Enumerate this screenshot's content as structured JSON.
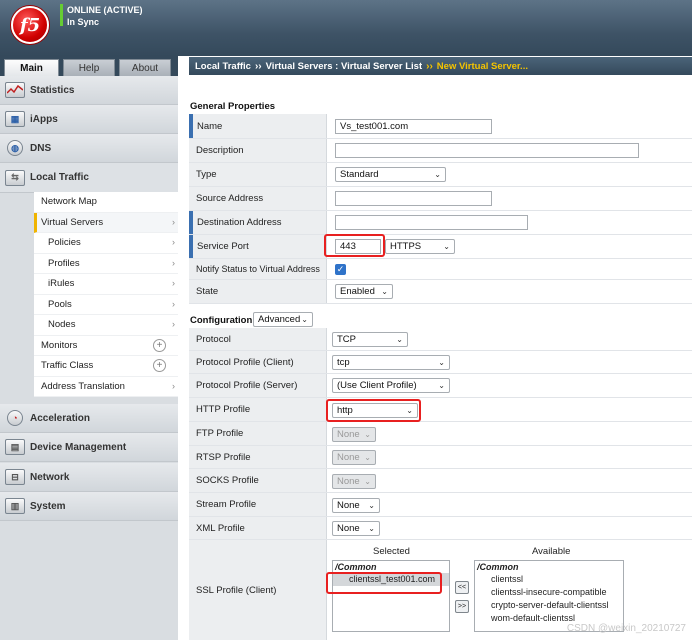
{
  "header": {
    "logo_text": "f5",
    "status_line1": "ONLINE (ACTIVE)",
    "status_line2": "In Sync"
  },
  "nav": {
    "tabs": [
      "Main",
      "Help",
      "About"
    ],
    "sections": [
      "Statistics",
      "iApps",
      "DNS",
      "Local Traffic",
      "Acceleration",
      "Device Management",
      "Network",
      "System"
    ],
    "local_traffic_items": [
      "Network Map",
      "Virtual Servers",
      "Policies",
      "Profiles",
      "iRules",
      "Pools",
      "Nodes",
      "Monitors",
      "Traffic Class",
      "Address Translation"
    ]
  },
  "breadcrumb": {
    "part1": "Local Traffic",
    "part2": "Virtual Servers : Virtual Server List",
    "current": "New Virtual Server...",
    "separator": "››"
  },
  "general": {
    "title": "General Properties",
    "name_label": "Name",
    "name_value": "Vs_test001.com",
    "description_label": "Description",
    "description_value": "",
    "type_label": "Type",
    "type_value": "Standard",
    "source_label": "Source Address",
    "source_value": "",
    "destination_label": "Destination Address",
    "destination_value": "",
    "service_port_label": "Service Port",
    "service_port_value": "443",
    "service_port_protocol": "HTTPS",
    "notify_label": "Notify Status to Virtual Address",
    "state_label": "State",
    "state_value": "Enabled"
  },
  "configuration": {
    "title": "Configuration:",
    "mode": "Advanced",
    "protocol_label": "Protocol",
    "protocol_value": "TCP",
    "protocol_profile_client_label": "Protocol Profile (Client)",
    "protocol_profile_client_value": "tcp",
    "protocol_profile_server_label": "Protocol Profile (Server)",
    "protocol_profile_server_value": "(Use Client Profile)",
    "http_profile_label": "HTTP Profile",
    "http_profile_value": "http",
    "ftp_profile_label": "FTP Profile",
    "ftp_profile_value": "None",
    "rtsp_profile_label": "RTSP Profile",
    "rtsp_profile_value": "None",
    "socks_profile_label": "SOCKS Profile",
    "socks_profile_value": "None",
    "stream_profile_label": "Stream Profile",
    "stream_profile_value": "None",
    "xml_profile_label": "XML Profile",
    "xml_profile_value": "None",
    "ssl_client_label": "SSL Profile (Client)",
    "selected_header": "Selected",
    "available_header": "Available",
    "group_common": "/Common",
    "selected_items": [
      "clientssl_test001.com"
    ],
    "available_items": [
      "clientssl",
      "clientssl-insecure-compatible",
      "crypto-server-default-clientssl",
      "wom-default-clientssl"
    ],
    "move_left": "<<",
    "move_right": ">>"
  },
  "watermark": "CSDN @weixin_20210727"
}
